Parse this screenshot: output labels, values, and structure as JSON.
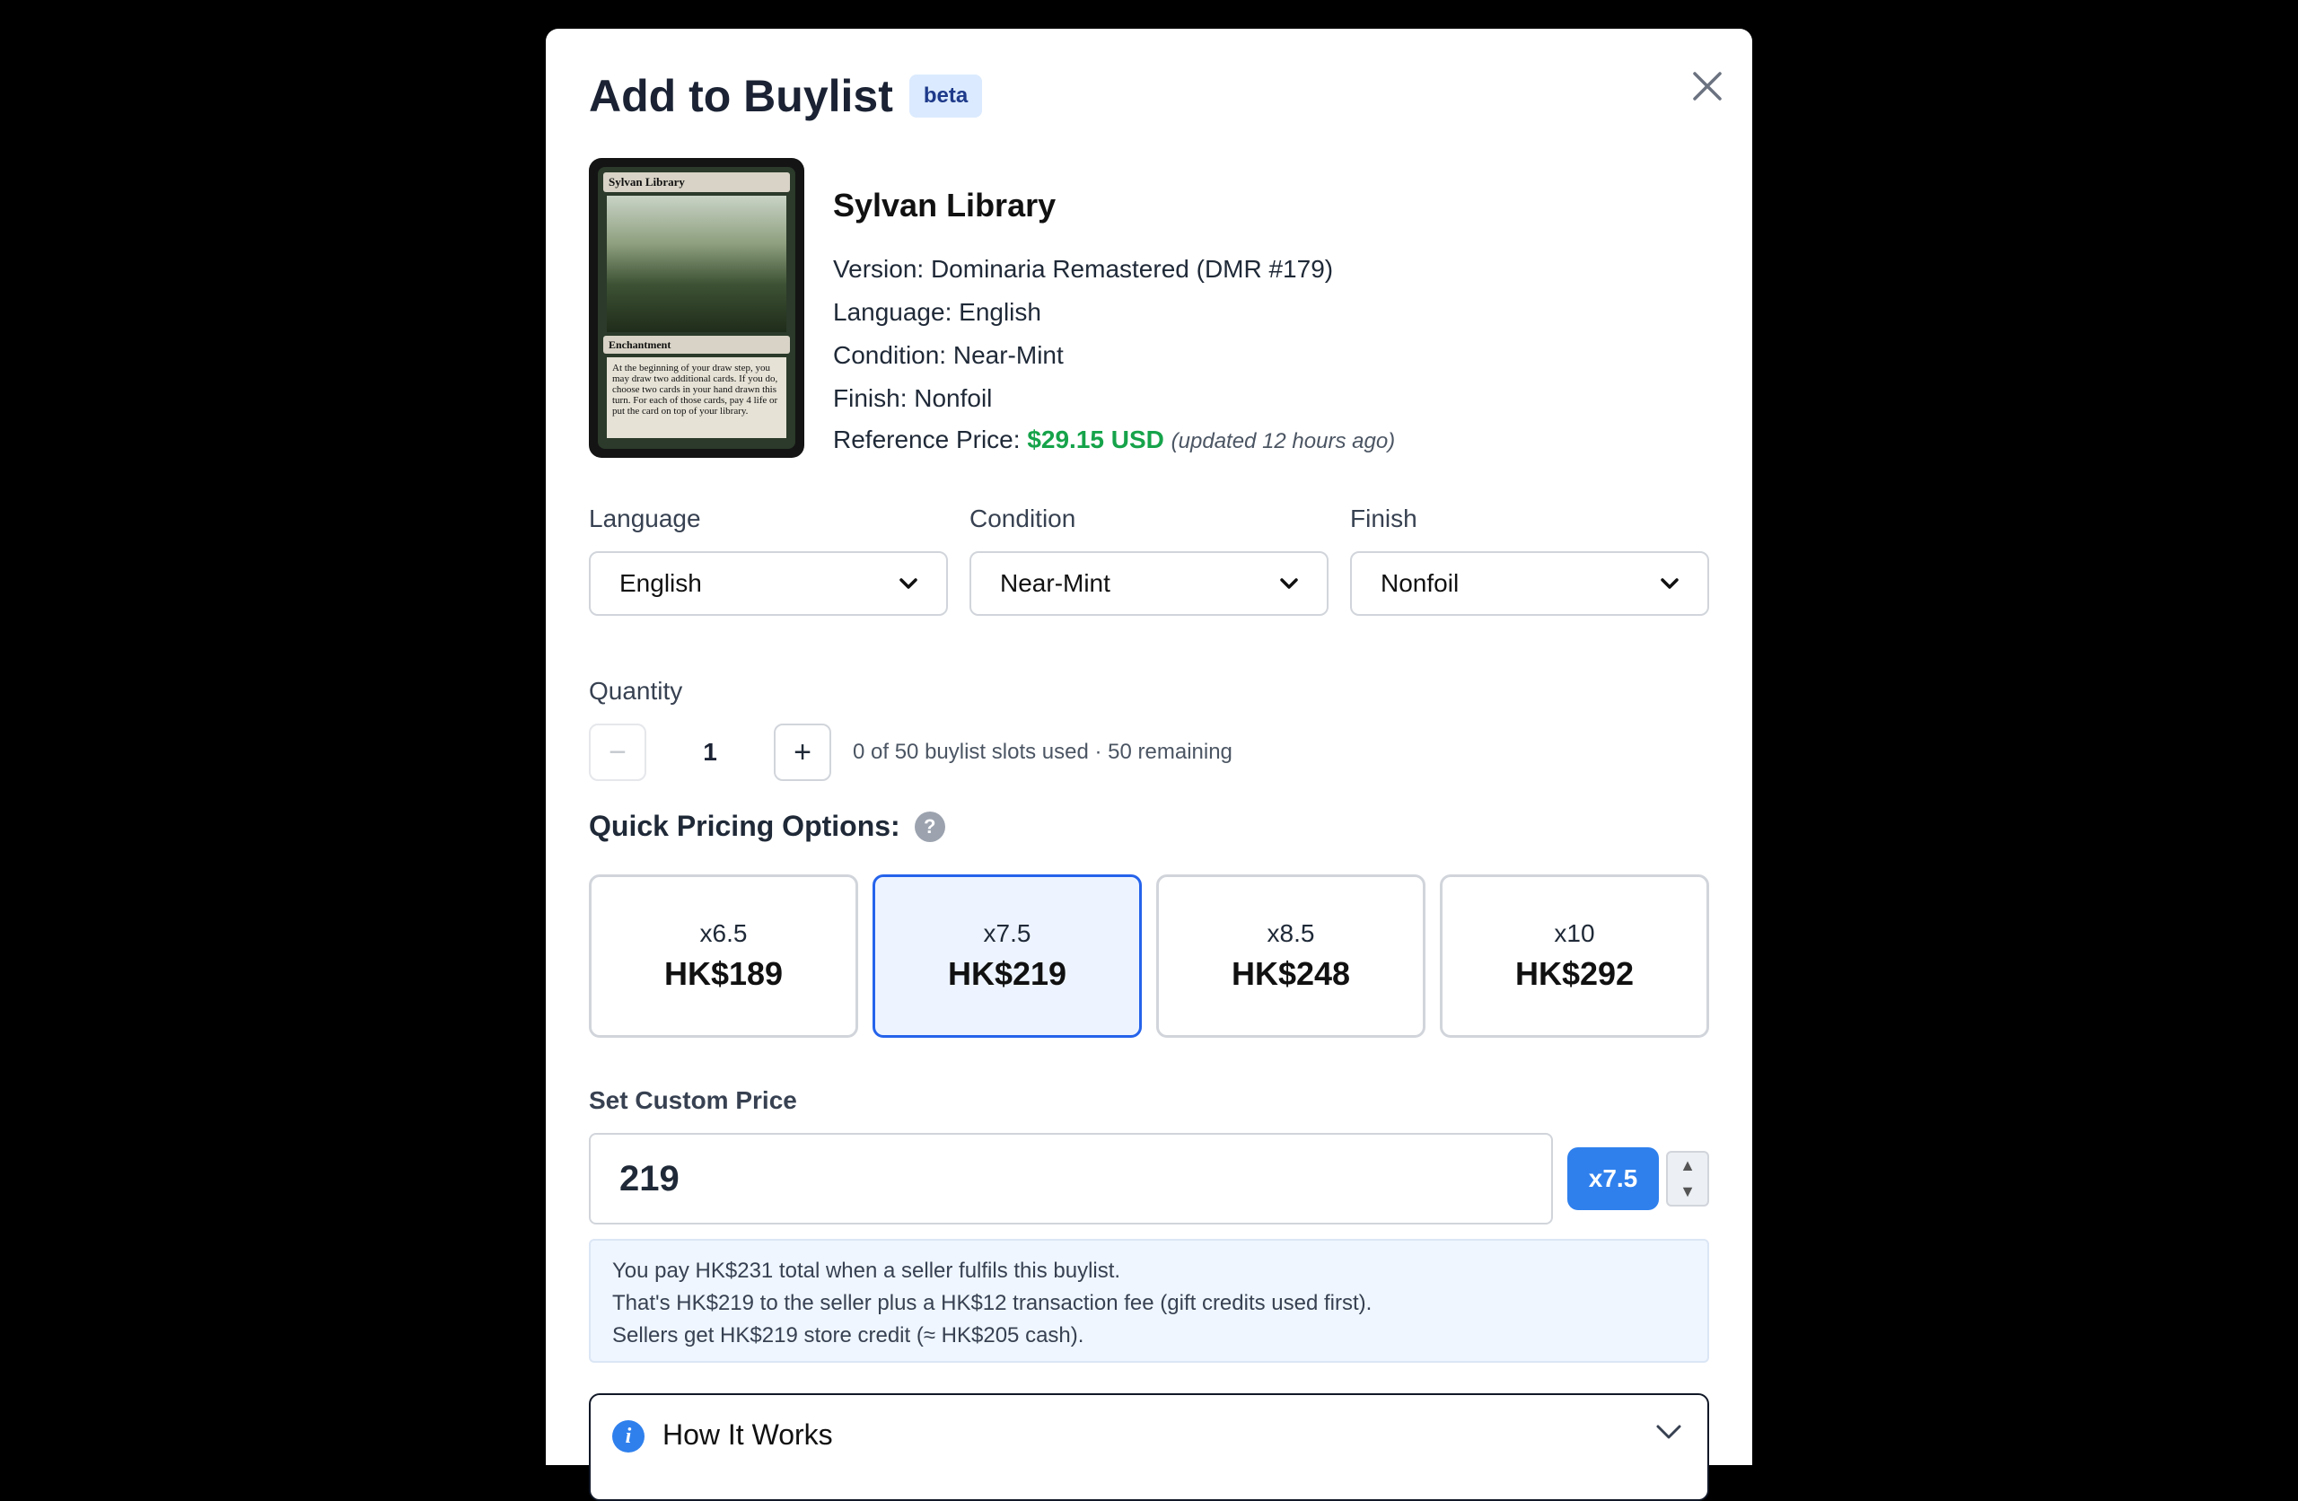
{
  "modal": {
    "title": "Add to Buylist",
    "badge": "beta"
  },
  "card": {
    "name": "Sylvan Library",
    "version": "Version: Dominaria Remastered (DMR #179)",
    "language": "Language: English",
    "condition": "Condition: Near-Mint",
    "finish": "Finish: Nonfoil",
    "reference_label": "Reference Price:",
    "reference_price": "$29.15 USD",
    "reference_updated": "(updated 12 hours ago)",
    "image": {
      "name_line": "Sylvan Library",
      "type_line": "Enchantment",
      "rules_text": "At the beginning of your draw step, you may draw two additional cards. If you do, choose two cards in your hand drawn this turn. For each of those cards, pay 4 life or put the card on top of your library."
    }
  },
  "filters": {
    "language_label": "Language",
    "language_value": "English",
    "condition_label": "Condition",
    "condition_value": "Near-Mint",
    "finish_label": "Finish",
    "finish_value": "Nonfoil"
  },
  "quantity": {
    "label": "Quantity",
    "minus": "−",
    "value": "1",
    "plus": "+",
    "slots": "0 of 50 buylist slots used · 50 remaining"
  },
  "quick_pricing": {
    "title": "Quick Pricing Options:",
    "help": "?",
    "options": [
      {
        "multiplier": "x6.5",
        "price": "HK$189"
      },
      {
        "multiplier": "x7.5",
        "price": "HK$219"
      },
      {
        "multiplier": "x8.5",
        "price": "HK$248"
      },
      {
        "multiplier": "x10",
        "price": "HK$292"
      }
    ],
    "selected_index": 1
  },
  "custom_price": {
    "label": "Set Custom Price",
    "value": "219",
    "multiplier": "x7.5",
    "spin_up": "▲",
    "spin_down": "▼"
  },
  "note": {
    "line1": "You pay HK$231 total when a seller fulfils this buylist.",
    "line2": "That's HK$219 to the seller plus a HK$12 transaction fee (gift credits used first).",
    "line3": "Sellers get HK$219 store credit (≈ HK$205 cash)."
  },
  "how_it_works": {
    "label": "How It Works",
    "icon": "i"
  },
  "colors": {
    "accent": "#2f80ed",
    "price_green": "#16a34a",
    "selected_border": "#2563eb"
  }
}
